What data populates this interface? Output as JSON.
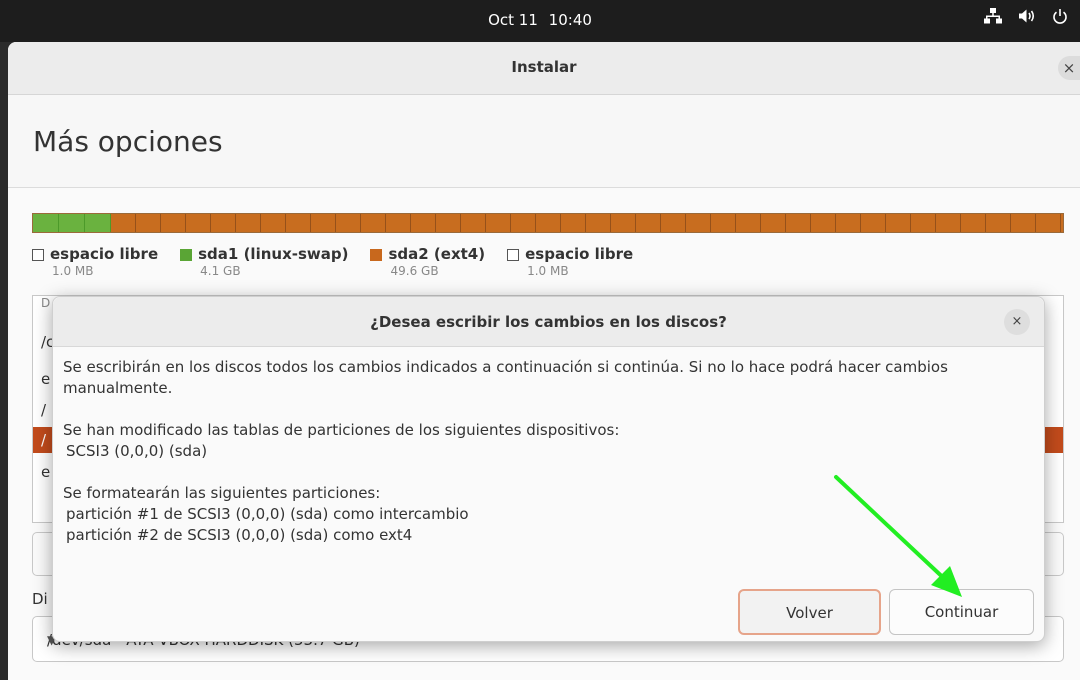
{
  "topbar": {
    "date": "Oct 11",
    "time": "10:40",
    "icons": [
      "network-icon",
      "volume-icon",
      "power-icon"
    ]
  },
  "window": {
    "title": "Instalar",
    "close_glyph": "×",
    "heading": "Más opciones"
  },
  "partitions": {
    "colors": {
      "swap": "#5aa535",
      "ext4": "#c8681d",
      "free": "#ffffff"
    },
    "swap_fraction": 0.076,
    "legend": [
      {
        "name": "espacio libre",
        "size": "1.0 MB",
        "kind": "free"
      },
      {
        "name": "sda1 (linux-swap)",
        "size": "4.1 GB",
        "kind": "swap"
      },
      {
        "name": "sda2 (ext4)",
        "size": "49.6 GB",
        "kind": "ext4"
      },
      {
        "name": "espacio libre",
        "size": "1.0 MB",
        "kind": "free"
      }
    ]
  },
  "list": {
    "header_fragment": "D",
    "rows": [
      "/c",
      "e",
      "/",
      "/",
      "e"
    ]
  },
  "device_label": "Di",
  "device_value": "/dev/sda - ATA VBOX HARDDISK (53.7 GB)",
  "dialog": {
    "title": "¿Desea escribir los cambios en los discos?",
    "close_glyph": "×",
    "paragraph1": "Se escribirán en los discos todos los cambios indicados a continuación si continúa. Si no lo hace podrá hacer cambios manualmente.",
    "paragraph2_title": "Se han modificado las tablas de particiones de los siguientes dispositivos:",
    "devices": [
      "SCSI3 (0,0,0) (sda)"
    ],
    "paragraph3_title": "Se formatearán las siguientes particiones:",
    "partitions": [
      "partición #1 de SCSI3 (0,0,0) (sda) como intercambio",
      "partición #2 de SCSI3 (0,0,0) (sda) como ext4"
    ],
    "back_label": "Volver",
    "continue_label": "Continuar"
  },
  "annotation": {
    "arrow_color": "#22ee22"
  }
}
